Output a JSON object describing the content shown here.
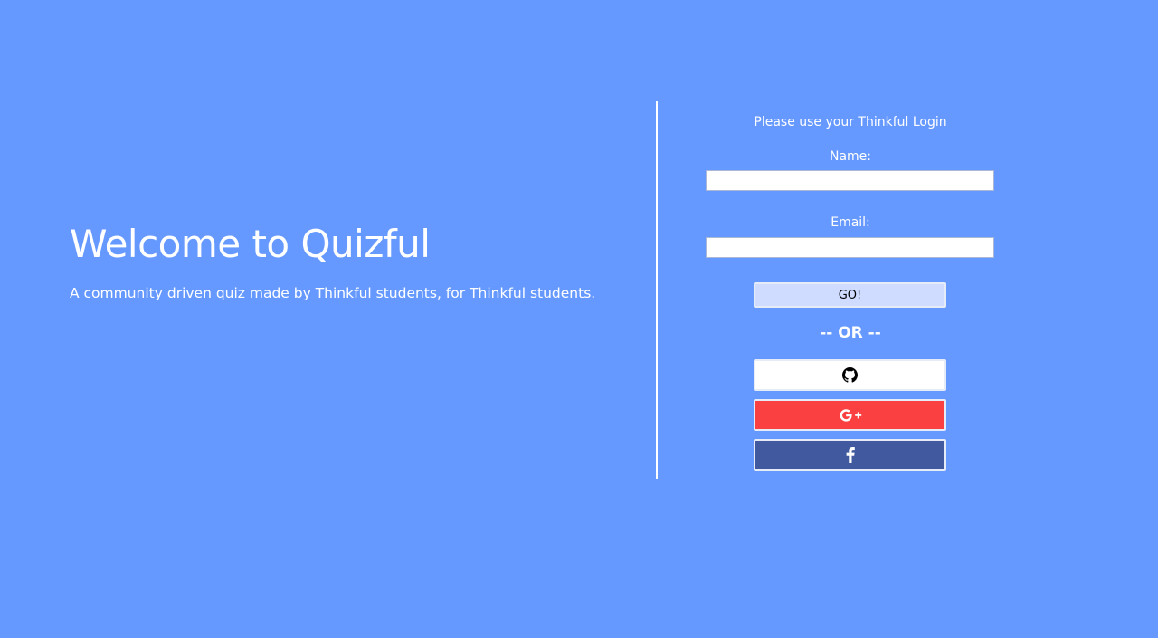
{
  "hero": {
    "title": "Welcome to Quizful",
    "subtitle": "A community driven quiz made by Thinkful students, for Thinkful students."
  },
  "login": {
    "prompt": "Please use your Thinkful Login",
    "name_label": "Name:",
    "name_value": "",
    "email_label": "Email:",
    "email_value": "",
    "go_label": "GO!",
    "or_text": "-- OR --"
  },
  "social": {
    "github_icon": "github-icon",
    "google_icon": "google-plus-icon",
    "facebook_icon": "facebook-icon"
  },
  "colors": {
    "background": "#6699ff",
    "go_button": "#cfdcff",
    "google_button": "#fa4040",
    "facebook_button": "#415a9f",
    "github_button": "#ffffff"
  }
}
